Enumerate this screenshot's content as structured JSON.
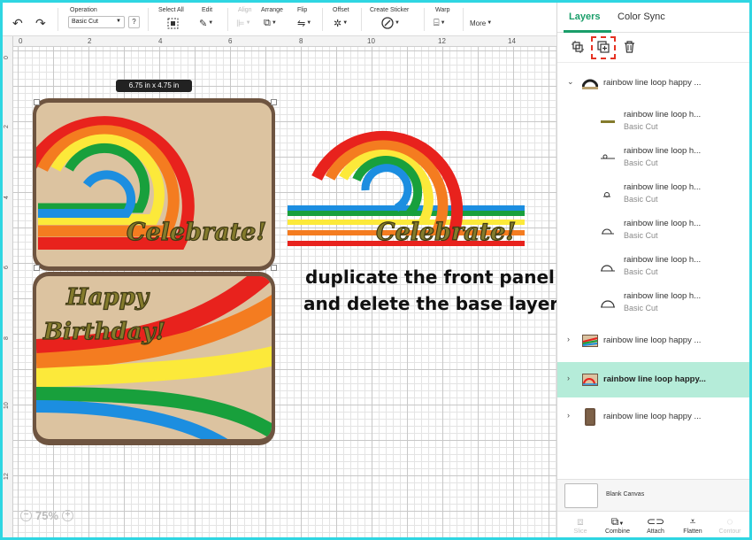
{
  "toolbar": {
    "undo_icon": "undo-icon",
    "redo_icon": "redo-icon",
    "operation_label": "Operation",
    "operation_value": "Basic Cut",
    "help_label": "?",
    "select_all_label": "Select All",
    "edit_label": "Edit",
    "align_label": "Align",
    "arrange_label": "Arrange",
    "flip_label": "Flip",
    "offset_label": "Offset",
    "create_sticker_label": "Create Sticker",
    "warp_label": "Warp",
    "more_label": "More"
  },
  "canvas": {
    "ruler_top": [
      "0",
      "2",
      "4",
      "6",
      "8",
      "10",
      "12",
      "14"
    ],
    "ruler_left": [
      "0",
      "2",
      "4",
      "6",
      "8",
      "10",
      "12"
    ],
    "dimension_tip": "6.75  in x 4.75  in",
    "card_text_front": "Celebrate!",
    "card_text_inside": [
      "Happy",
      "Birthday!"
    ],
    "annotation_line1": "duplicate the front panel",
    "annotation_line2": "and delete the base layer",
    "zoom_out": "−",
    "zoom_value": "75%",
    "zoom_in": "+",
    "colors": {
      "tan": "#dcc3a0",
      "brown": "#6e5440",
      "red": "#e8221d",
      "orange": "#f47c20",
      "yellow": "#fce93a",
      "green": "#18a03c",
      "blue": "#1c8ee0",
      "olive": "#847b2c"
    }
  },
  "panel": {
    "tab_layers": "Layers",
    "tab_color_sync": "Color Sync",
    "tools": [
      "group-icon",
      "duplicate-icon",
      "delete-icon"
    ],
    "layers": [
      {
        "name": "rainbow line loop happy ...",
        "expanded": true,
        "selected": false
      },
      {
        "name": "rainbow line loop h...",
        "op": "Basic Cut",
        "child": true
      },
      {
        "name": "rainbow line loop h...",
        "op": "Basic Cut",
        "child": true
      },
      {
        "name": "rainbow line loop h...",
        "op": "Basic Cut",
        "child": true
      },
      {
        "name": "rainbow line loop h...",
        "op": "Basic Cut",
        "child": true
      },
      {
        "name": "rainbow line loop h...",
        "op": "Basic Cut",
        "child": true
      },
      {
        "name": "rainbow line loop h...",
        "op": "Basic Cut",
        "child": true
      },
      {
        "name": "rainbow line loop happy ...",
        "expanded": false,
        "selected": false
      },
      {
        "name": "rainbow line loop happy...",
        "expanded": false,
        "selected": true
      },
      {
        "name": "rainbow line loop happy ...",
        "expanded": false,
        "selected": false
      }
    ],
    "blank_canvas_label": "Blank Canvas",
    "bottom": {
      "slice": "Slice",
      "combine": "Combine",
      "attach": "Attach",
      "flatten": "Flatten",
      "contour": "Contour"
    }
  }
}
